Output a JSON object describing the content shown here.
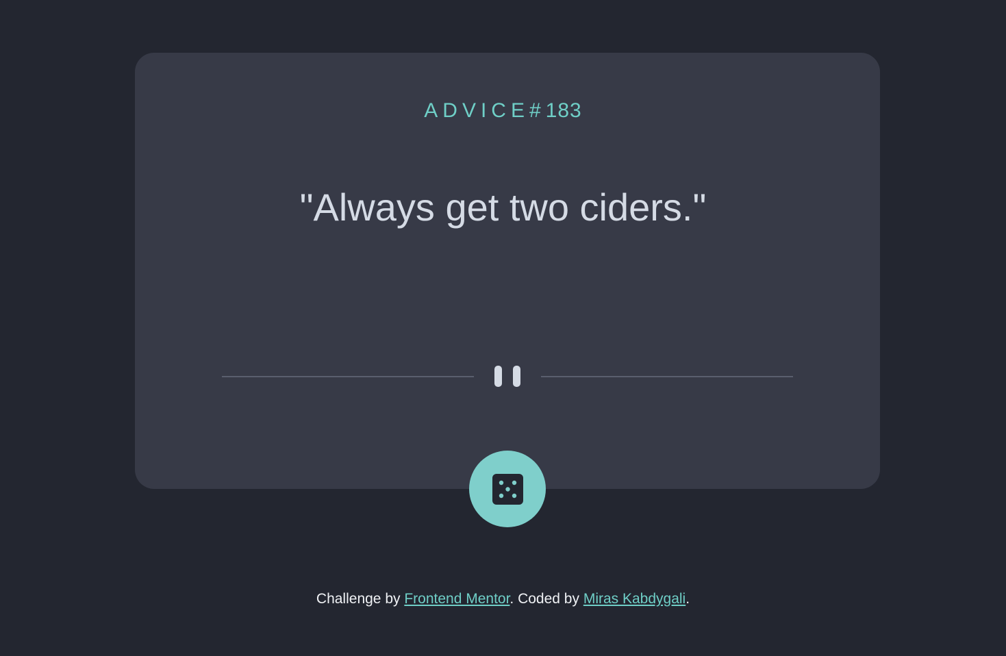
{
  "advice": {
    "label": "ADVICE#",
    "number": "183",
    "quote": "\"Always get two ciders.\""
  },
  "footer": {
    "prefix": "Challenge by ",
    "challenge_link": "Frontend Mentor",
    "middle": ". Coded by ",
    "author_link": "Miras Kabdygali",
    "suffix": "."
  },
  "colors": {
    "background": "#232630",
    "card": "#373a47",
    "accent": "#6fcfc7",
    "button": "#7fcfcb",
    "text": "#d5dbe5"
  },
  "icons": {
    "divider": "pause-icon",
    "button": "dice-icon"
  }
}
